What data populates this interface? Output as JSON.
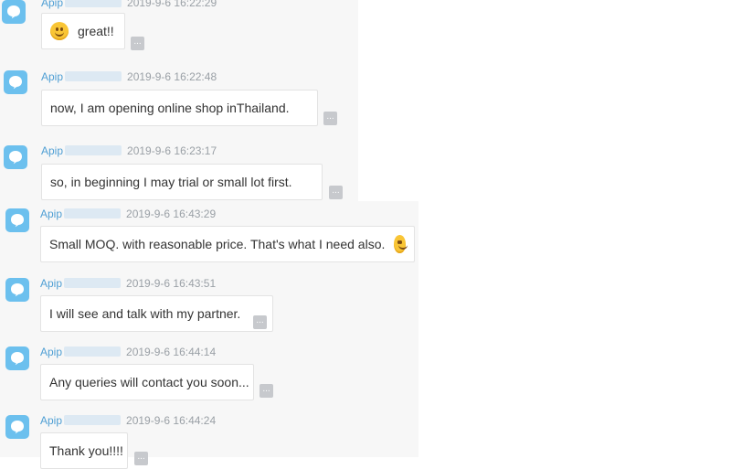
{
  "messages": [
    {
      "sender": "Apip",
      "time": "2019-9-6 16:22:29",
      "text": "great!!",
      "emoji_leading": true,
      "emoji_trailing": false
    },
    {
      "sender": "Apip",
      "time": "2019-9-6 16:22:48",
      "text": "now, I am opening online shop inThailand.",
      "emoji_leading": false,
      "emoji_trailing": false
    },
    {
      "sender": "Apip",
      "time": "2019-9-6 16:23:17",
      "text": "so, in beginning I may trial or small lot first.",
      "emoji_leading": false,
      "emoji_trailing": false
    },
    {
      "sender": "Apip",
      "time": "2019-9-6 16:43:29",
      "text": "Small MOQ. with reasonable price.  That's what I need also.",
      "emoji_leading": false,
      "emoji_trailing": true
    },
    {
      "sender": "Apip",
      "time": "2019-9-6 16:43:51",
      "text": "I will see and talk with my partner.",
      "emoji_leading": false,
      "emoji_trailing": false
    },
    {
      "sender": "Apip",
      "time": "2019-9-6 16:44:14",
      "text": "Any queries will contact you soon...",
      "emoji_leading": false,
      "emoji_trailing": false
    },
    {
      "sender": "Apip",
      "time": "2019-9-6 16:44:24",
      "text": "Thank you!!!!",
      "emoji_leading": false,
      "emoji_trailing": false
    }
  ],
  "more_label": "...",
  "colors": {
    "avatar": "#6cc0ee",
    "sender": "#4f9fd4",
    "timestamp": "#9aa0a6",
    "panel": "#f7f7f7",
    "bubble_border": "#e3e3e3",
    "more_button": "#c7c9cd"
  },
  "icons": {
    "avatar": "chat-bubble-icon",
    "emoji": "smiley-emoji-icon",
    "more": "more-options-icon"
  }
}
